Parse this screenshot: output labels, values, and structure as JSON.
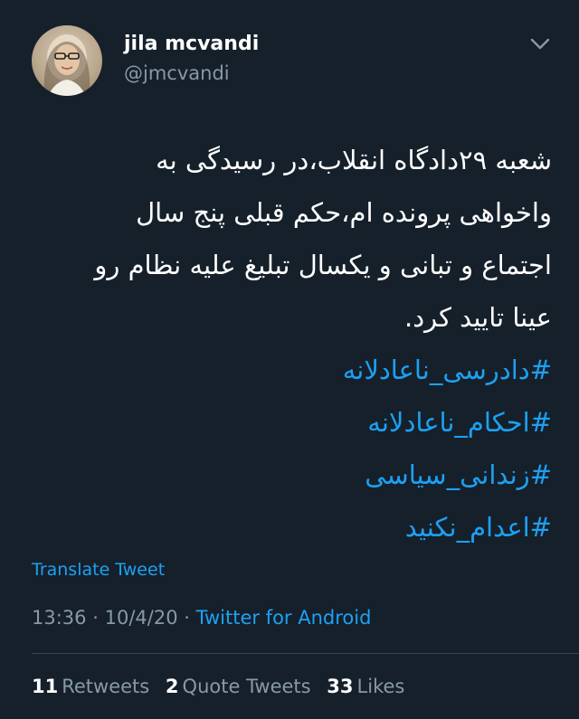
{
  "user": {
    "display_name": "jila mcvandi",
    "handle": "@jmcvandi"
  },
  "tweet": {
    "lines": [
      "شعبه ۲۹دادگاه انقلاب،در رسیدگی به",
      "واخواهی پرونده ام،حکم قبلی پنج سال",
      "اجتماع و تبانی و یکسال تبلیغ علیه نظام رو",
      "عینا تایید کرد."
    ],
    "hashtags": [
      "#دادرسی_ناعادلانه",
      "#احکام_ناعادلانه",
      "#زندانی_سیاسی",
      "#اعدام_نکنید"
    ],
    "translate_label": "Translate Tweet",
    "time": "13:36",
    "date": "10/4/20",
    "separator": "·",
    "source": "Twitter for Android"
  },
  "stats": {
    "retweets_count": "11",
    "retweets_label": "Retweets",
    "quotes_count": "2",
    "quotes_label": "Quote Tweets",
    "likes_count": "33",
    "likes_label": "Likes"
  },
  "colors": {
    "background": "#15202b",
    "text": "#ffffff",
    "secondary": "#8899a6",
    "accent": "#1da1f2",
    "divider": "#38444d"
  },
  "icons": {
    "menu": "chevron-down-icon"
  }
}
